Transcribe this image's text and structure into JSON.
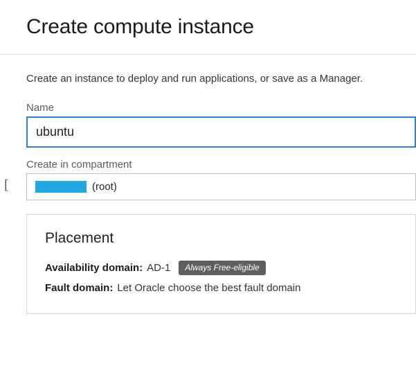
{
  "header": {
    "title": "Create compute instance"
  },
  "description": "Create an instance to deploy and run applications, or save as a Manager.",
  "fields": {
    "name": {
      "label": "Name",
      "value": "ubuntu"
    },
    "compartment": {
      "label": "Create in compartment",
      "redacted": true,
      "suffix": "(root)"
    }
  },
  "placement": {
    "title": "Placement",
    "availability_domain": {
      "label": "Availability domain:",
      "value": "AD-1",
      "badge": "Always Free-eligible"
    },
    "fault_domain": {
      "label": "Fault domain:",
      "value": "Let Oracle choose the best fault domain"
    }
  }
}
